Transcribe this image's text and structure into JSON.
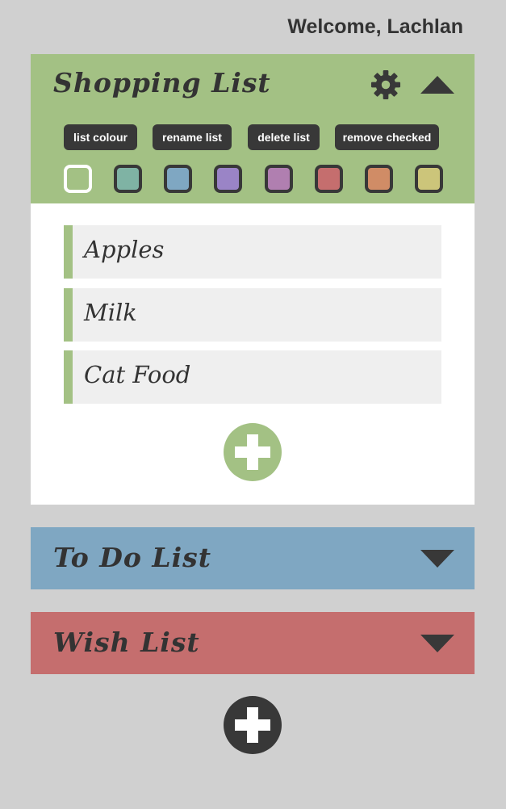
{
  "welcome": "Welcome, Lachlan",
  "colors": {
    "background": "#d0d0d0",
    "dark": "#383838",
    "text": "#333333",
    "item_bg": "#efefef"
  },
  "lists": [
    {
      "title": "Shopping List",
      "color": "#a3c184",
      "expanded": true,
      "settings_open": true,
      "items": [
        "Apples",
        "Milk",
        "Cat Food"
      ]
    },
    {
      "title": "To Do List",
      "color": "#7fa7c2",
      "expanded": false
    },
    {
      "title": "Wish List",
      "color": "#c56e6e",
      "expanded": false
    }
  ],
  "settings": {
    "list_colour_label": "list colour",
    "rename_label": "rename list",
    "delete_label": "delete list",
    "remove_checked_label": "remove checked"
  },
  "swatches": [
    {
      "color": "#a3c184",
      "selected": true
    },
    {
      "color": "#7fb3a4",
      "selected": false
    },
    {
      "color": "#7fa7c2",
      "selected": false
    },
    {
      "color": "#9a84c6",
      "selected": false
    },
    {
      "color": "#b07fb0",
      "selected": false
    },
    {
      "color": "#c56e6e",
      "selected": false
    },
    {
      "color": "#d08c66",
      "selected": false
    },
    {
      "color": "#ccc57a",
      "selected": false
    }
  ],
  "icons": {
    "settings": "gear-icon",
    "collapse": "chevron-up-icon",
    "expand": "chevron-down-icon",
    "add": "plus-icon"
  }
}
